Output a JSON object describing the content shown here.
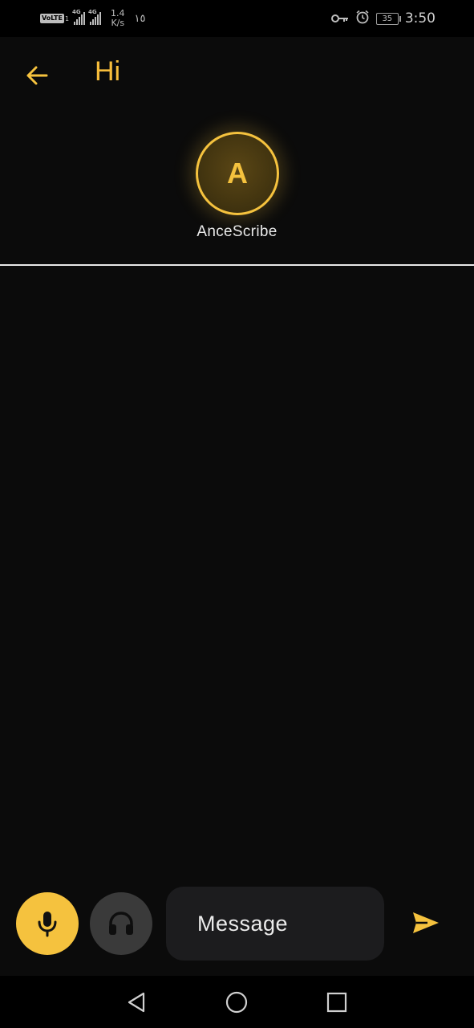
{
  "status_bar": {
    "volte": "VoLTE",
    "sim1_slot": "1",
    "network1": "4G",
    "network2": "4G",
    "speed_value": "1.4",
    "speed_unit": "K/s",
    "extra_indicator": "١٥",
    "battery": "35",
    "time": "3:50",
    "icons": [
      "vpn-key-icon",
      "alarm-icon",
      "battery-icon"
    ]
  },
  "header": {
    "back_icon": "arrow-left-icon",
    "title": "Hi"
  },
  "profile": {
    "avatar_initial": "A",
    "name": "AnceScribe"
  },
  "composer": {
    "mic_icon": "microphone-icon",
    "headset_icon": "headphones-icon",
    "placeholder": "Message",
    "value": "",
    "send_icon": "send-icon"
  },
  "nav_bar": {
    "icons": [
      "back-triangle-icon",
      "home-circle-icon",
      "recents-square-icon"
    ]
  },
  "colors": {
    "accent": "#f5c23e",
    "background": "#0b0b0b",
    "input_bg": "#1c1c1e",
    "secondary_button": "#3a3a3a"
  }
}
